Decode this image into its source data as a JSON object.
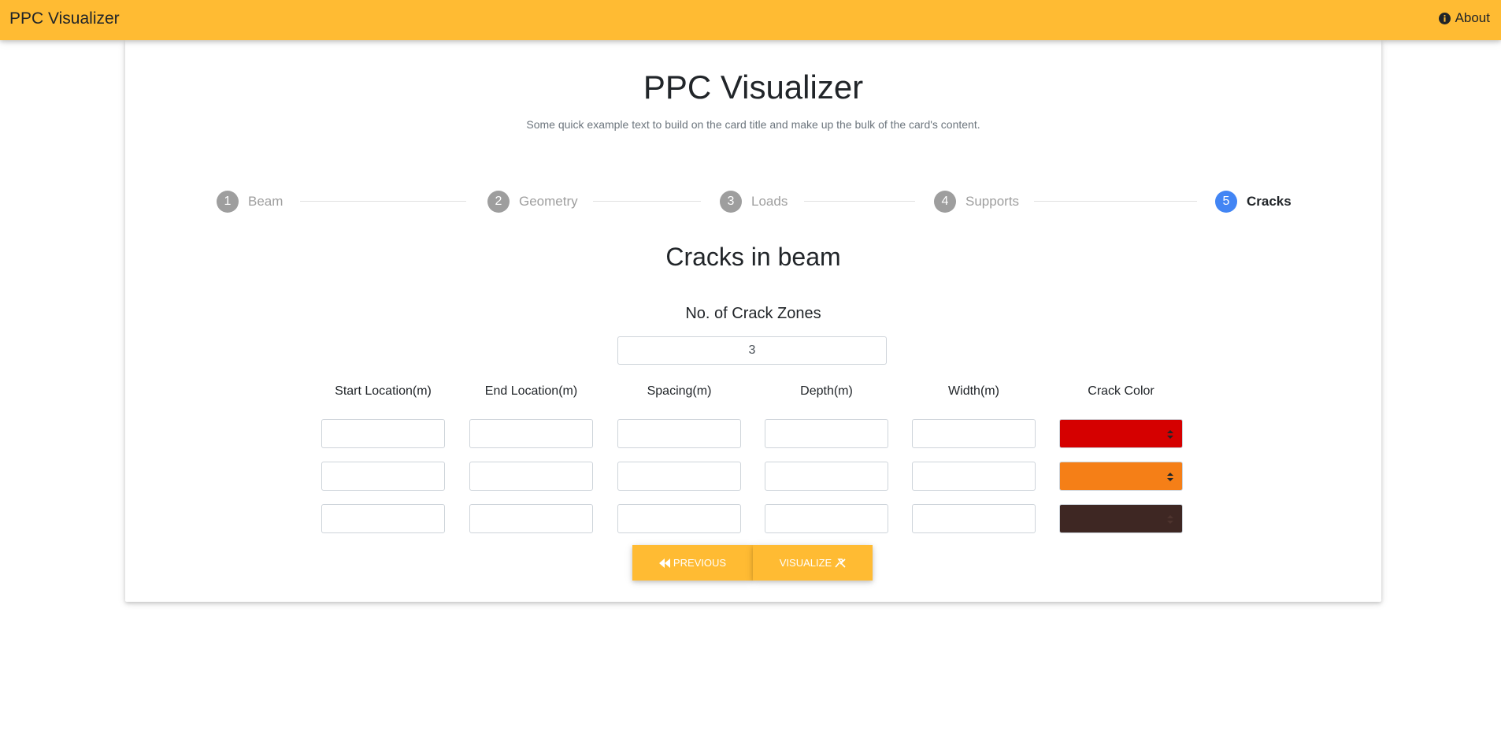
{
  "navbar": {
    "brand": "PPC Visualizer",
    "about_label": "About",
    "about_icon": "info-circle-icon"
  },
  "card": {
    "title": "PPC Visualizer",
    "subtitle": "Some quick example text to build on the card title and make up the bulk of the card's content."
  },
  "stepper": {
    "steps": [
      {
        "number": "1",
        "label": "Beam"
      },
      {
        "number": "2",
        "label": "Geometry"
      },
      {
        "number": "3",
        "label": "Loads"
      },
      {
        "number": "4",
        "label": "Supports"
      },
      {
        "number": "5",
        "label": "Cracks"
      }
    ],
    "active_step": "5"
  },
  "cracks": {
    "section_title": "Cracks in beam",
    "zones_label": "No. of Crack Zones",
    "zones_value": "3",
    "columns": [
      "Start Location(m)",
      "End Location(m)",
      "Spacing(m)",
      "Depth(m)",
      "Width(m)",
      "Crack Color"
    ],
    "rows": [
      {
        "start": "",
        "end": "",
        "spacing": "",
        "depth": "",
        "width": "",
        "color": "#d50000"
      },
      {
        "start": "",
        "end": "",
        "spacing": "",
        "depth": "",
        "width": "",
        "color": "#f57f17"
      },
      {
        "start": "",
        "end": "",
        "spacing": "",
        "depth": "",
        "width": "",
        "color": "#3e2723"
      }
    ]
  },
  "buttons": {
    "previous": "Previous",
    "previous_icon": "double-left-arrow-icon",
    "visualize": "Visualize",
    "visualize_icon": "wrench-hammer-icon"
  },
  "colors": {
    "accent": "#ffbb33",
    "active_step": "#4285f4",
    "inactive_step": "#9e9e9e"
  }
}
